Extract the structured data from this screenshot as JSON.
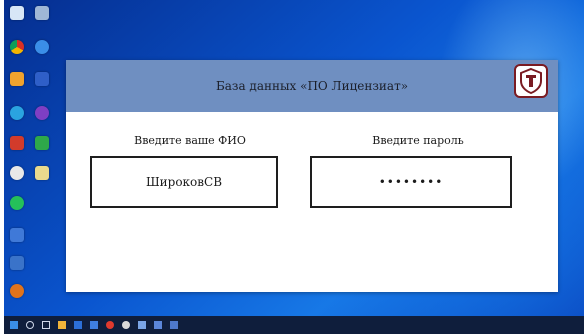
{
  "desktop": {
    "icons": [
      {
        "name": "recycle-bin",
        "color": "#d7e6f6",
        "caption": ""
      },
      {
        "name": "this-pc",
        "color": "#9fb7d6",
        "caption": ""
      },
      {
        "name": "chrome",
        "color": "#f2f2f2",
        "caption": ""
      },
      {
        "name": "edge",
        "color": "#3a8ee8",
        "caption": ""
      },
      {
        "name": "folder-shortcut",
        "color": "#f0a32e",
        "caption": ""
      },
      {
        "name": "app-shortcut",
        "color": "#2f5fc8",
        "caption": ""
      },
      {
        "name": "telegram",
        "color": "#2aa3e0",
        "caption": ""
      },
      {
        "name": "app-purple",
        "color": "#7e3fc4",
        "caption": ""
      },
      {
        "name": "app-red",
        "color": "#d23b2b",
        "caption": ""
      },
      {
        "name": "app-green",
        "color": "#2ea84a",
        "caption": ""
      },
      {
        "name": "yandex",
        "color": "#e8e8e8",
        "caption": ""
      },
      {
        "name": "document-shortcut",
        "color": "#e9d98d",
        "caption": ""
      },
      {
        "name": "whatsapp",
        "color": "#25c05a",
        "caption": ""
      },
      {
        "name": "app-blue",
        "color": "#3f79d8",
        "caption": ""
      },
      {
        "name": "app-monitor",
        "color": "#3a73c9",
        "caption": ""
      },
      {
        "name": "app-orange",
        "color": "#e0731c",
        "caption": ""
      }
    ]
  },
  "app": {
    "title": "База данных «ПО Лицензиат»",
    "logo": "shield-logo",
    "colors": {
      "title_bar": "#6f8fc1",
      "logo_border": "#7a1b22"
    },
    "login": {
      "name_label": "Введите ваше ФИО",
      "name_value": "ШироковСВ",
      "password_label": "Введите пароль",
      "password_value": "••••••••"
    }
  },
  "taskbar": {
    "items": [
      "start-icon",
      "search-icon",
      "task-view-icon",
      "explorer-icon",
      "store-icon",
      "mail-icon",
      "settings-icon",
      "chrome-icon",
      "app-icon",
      "app-icon",
      "app-icon"
    ],
    "clock": ""
  }
}
